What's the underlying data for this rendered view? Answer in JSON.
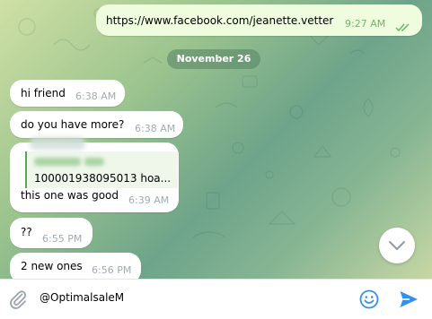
{
  "chat": {
    "date_separator": "November 26",
    "messages": [
      {
        "text": "https://www.facebook.com/jeanette.vetter",
        "time": "9:27 AM",
        "outgoing": true
      },
      {
        "text": "hi friend",
        "time": "6:38 AM"
      },
      {
        "text": "do you have more?",
        "time": "6:38 AM"
      },
      {
        "reply_preview": "100001938095013  hoa...",
        "text": "this one was good",
        "time": "6:39 AM"
      },
      {
        "text": "??",
        "time": "6:55 PM"
      },
      {
        "text": "2 new ones",
        "time": "6:56 PM"
      }
    ]
  },
  "composer": {
    "input_value": "@OptimalsaleM",
    "attach_icon": "paperclip-icon",
    "emoji_icon": "smiley-icon",
    "send_icon": "send-icon"
  },
  "scroll_button": {
    "icon": "chevron-down-icon"
  },
  "colors": {
    "outgoing_bubble": "#effdde",
    "incoming_bubble": "#ffffff",
    "link": "#2a8ac4",
    "accent": "#3390ec"
  }
}
